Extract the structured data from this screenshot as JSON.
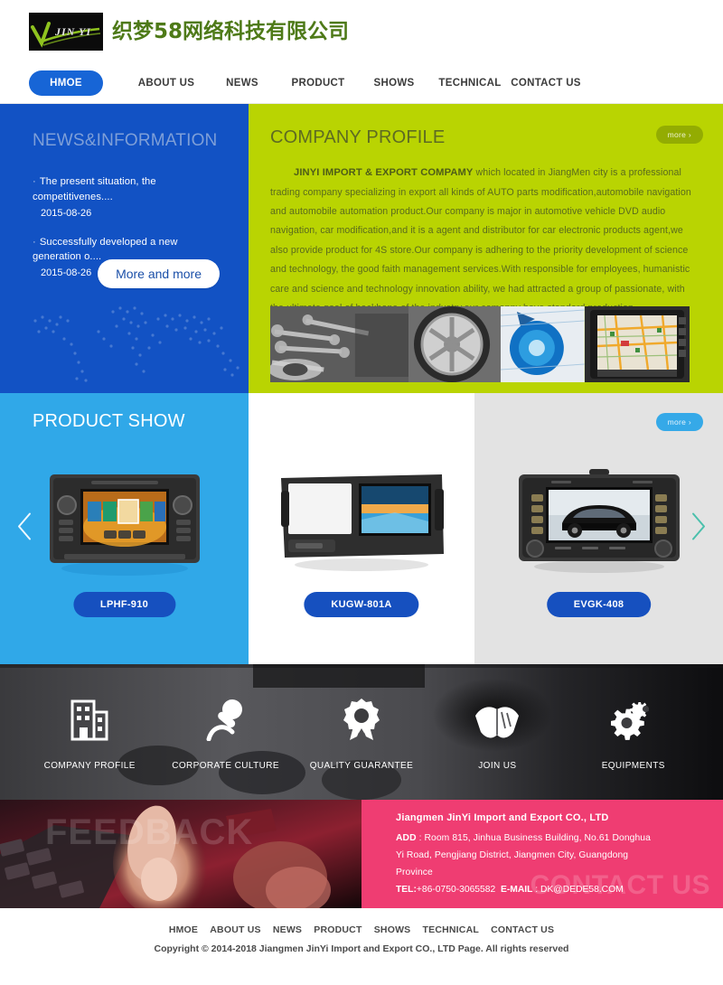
{
  "header": {
    "logo_mark": "JIN YI",
    "company_name_cn": "织梦58网络科技有限公司"
  },
  "nav": {
    "items": [
      {
        "label": "HMOE",
        "active": true
      },
      {
        "label": "ABOUT US",
        "active": false
      },
      {
        "label": "NEWS",
        "active": false
      },
      {
        "label": "PRODUCT",
        "active": false
      },
      {
        "label": "SHOWS",
        "active": false
      },
      {
        "label": "TECHNICAL",
        "active": false
      },
      {
        "label": "CONTACT US",
        "active": false
      }
    ]
  },
  "news": {
    "title_main": "NEWS",
    "title_sub": "&INFORMATION",
    "items": [
      {
        "bullet": "·",
        "title": "The present situation, the competitivenes....",
        "date": "2015-08-26"
      },
      {
        "bullet": "·",
        "title": "Successfully developed a new generation o....",
        "date": "2015-08-26"
      }
    ],
    "more_label": "More and more"
  },
  "profile": {
    "title": "COMPANY PROFILE",
    "more_label": "more ›",
    "lead": "JINYI IMPORT & EXPORT COMPAMY",
    "body": " which located in JiangMen city is a professional trading company specializing in export all kinds of AUTO parts modification,automobile navigation and automobile automation product.Our company is major in automotive vehicle DVD audio navigation, car modification,and it is a agent and distributor for car electronic products agent,we also provide product for 4S store.Our company is adhering to the priority development of science and technology, the good faith management services.With responsible for employees, humanistic care and science and technology innovation ability, we had attracted a group of passionate, with the ultimate goal of backbone of the industry,our comapny have standard production …"
  },
  "products": {
    "title": "PRODUCT SHOW",
    "more_label": "more ›",
    "prev_icon": "chevron-left-icon",
    "next_icon": "chevron-right-icon",
    "items": [
      {
        "name": "LPHF-910"
      },
      {
        "name": "KUGW-801A"
      },
      {
        "name": "EVGK-408"
      }
    ]
  },
  "features": {
    "items": [
      {
        "label": "COMPANY PROFILE",
        "icon": "building-icon"
      },
      {
        "label": "CORPORATE CULTURE",
        "icon": "microphone-icon"
      },
      {
        "label": "QUALITY GUARANTEE",
        "icon": "award-ribbon-icon"
      },
      {
        "label": "JOIN US",
        "icon": "handshake-icon"
      },
      {
        "label": "EQUIPMENTS",
        "icon": "gears-icon"
      }
    ]
  },
  "feedback": {
    "watermark": "FEEDBACK"
  },
  "contact": {
    "watermark": "CONTACT US",
    "company": "Jiangmen JinYi Import and Export CO., LTD",
    "add_label": "ADD",
    "address_line1": " : Room 815, Jinhua Business Building, No.61 Donghua",
    "address_line2": "Yi Road, Pengjiang District, Jiangmen City, Guangdong",
    "address_line3": "Province",
    "tel_label": "TEL:",
    "tel_value": "+86-0750-3065582",
    "email_label": "E-MAIL",
    "email_value": " : DK@DEDE58.COM"
  },
  "footer": {
    "nav": [
      "HMOE",
      "ABOUT US",
      "NEWS",
      "PRODUCT",
      "SHOWS",
      "TECHNICAL",
      "CONTACT US"
    ],
    "copyright": "Copyright © 2014-2018 Jiangmen JinYi Import and Export CO., LTD   Page. All rights reserved"
  },
  "colors": {
    "nav_active": "#1765d6",
    "news_bg": "#1252c4",
    "profile_bg": "#b9d402",
    "product_blue": "#30a8e8",
    "product_gray": "#e3e3e3",
    "contact_pink": "#ef3d72",
    "product_btn": "#1650bf"
  }
}
